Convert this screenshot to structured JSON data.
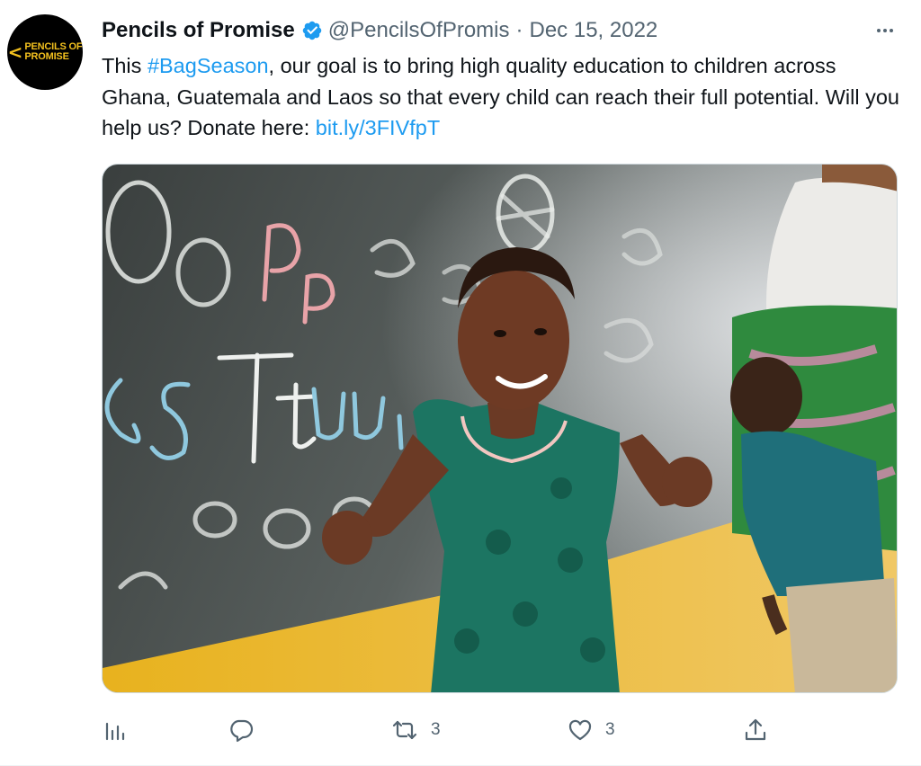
{
  "account": {
    "name": "Pencils of Promise",
    "handle": "@PencilsOfPromis",
    "separator": "·",
    "date": "Dec 15, 2022",
    "avatar_logo_lines": [
      "PENCILS OF",
      "PROMISE"
    ]
  },
  "tweet": {
    "text_before": "This ",
    "hashtag": "#BagSeason",
    "text_after": ", our goal is to bring high quality education to children across Ghana, Guatemala and Laos so that every child can reach their full potential. Will you help us? Donate here: ",
    "link": "bit.ly/3FIVfpT"
  },
  "actions": {
    "analytics": {
      "icon": "bar-chart-icon"
    },
    "reply": {
      "icon": "speech-bubble-icon"
    },
    "retweet": {
      "icon": "retweet-icon",
      "count": "3"
    },
    "like": {
      "icon": "heart-icon",
      "count": "3"
    },
    "share": {
      "icon": "share-upload-icon"
    }
  },
  "colors": {
    "text": "#0f1419",
    "secondary": "#536471",
    "link": "#1d9bf0",
    "verified": "#1d9bf0",
    "brand_yellow": "#f2c01e"
  }
}
